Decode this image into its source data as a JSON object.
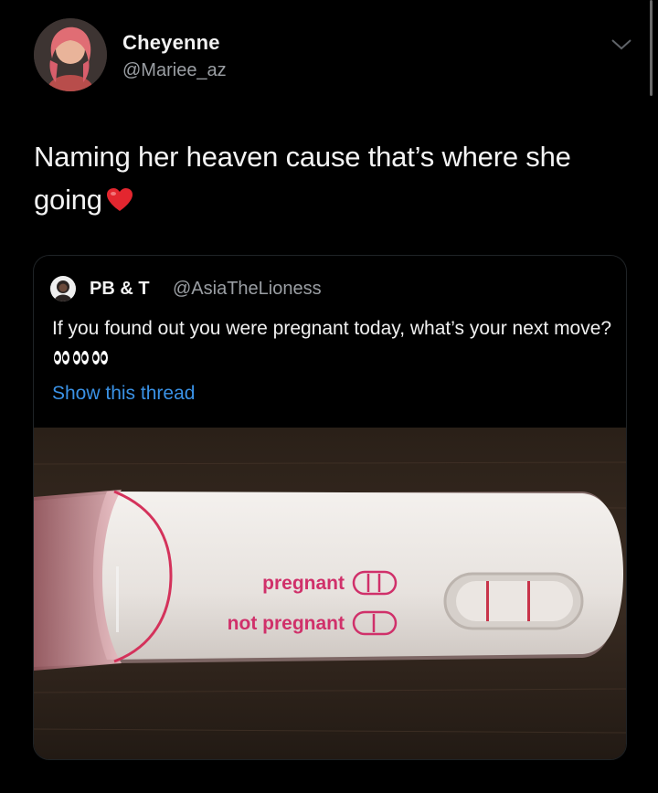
{
  "tweet": {
    "display_name": "Cheyenne",
    "handle": "@Mariee_az",
    "text": "Naming her heaven cause that’s where she going",
    "emoji": "heart-icon"
  },
  "quoted_tweet": {
    "display_name": "PB & T",
    "handle": "@AsiaTheLioness",
    "text": "If you found out you were pregnant today, what’s your next move?",
    "emoji": "eyes-icon",
    "show_thread": "Show this thread"
  },
  "image": {
    "description_labels": {
      "pregnant": "pregnant",
      "not_pregnant": "not pregnant"
    }
  },
  "colors": {
    "background": "#000000",
    "link": "#3a92e6",
    "secondary_text": "#9a9ea3",
    "test_accent": "#d0306a"
  }
}
